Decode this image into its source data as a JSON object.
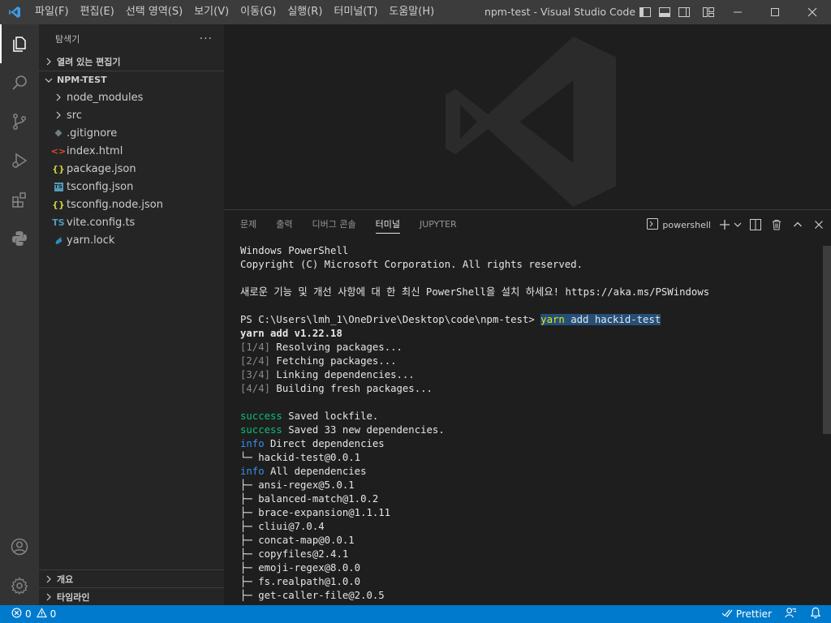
{
  "titlebar": {
    "menu": [
      "파일(F)",
      "편집(E)",
      "선택 영역(S)",
      "보기(V)",
      "이동(G)",
      "실행(R)",
      "터미널(T)",
      "도움말(H)"
    ],
    "title": "npm-test - Visual Studio Code"
  },
  "sidebar": {
    "header": "탐색기",
    "open_editors": "열려 있는 편집기",
    "project": "NPM-TEST",
    "items": [
      {
        "label": "node_modules",
        "type": "folder",
        "icon": "chevron-right-icon"
      },
      {
        "label": "src",
        "type": "folder",
        "icon": "chevron-right-icon"
      },
      {
        "label": ".gitignore",
        "type": "file",
        "icon": "gitignore-icon",
        "glyph": "◆",
        "color": "#6d8086"
      },
      {
        "label": "index.html",
        "type": "file",
        "icon": "html-icon",
        "glyph": "<>",
        "color": "#e44d26"
      },
      {
        "label": "package.json",
        "type": "file",
        "icon": "json-icon",
        "glyph": "{}",
        "color": "#cbcb41"
      },
      {
        "label": "tsconfig.json",
        "type": "file",
        "icon": "tsconfig-icon",
        "glyph": "TS",
        "color": "#519aba"
      },
      {
        "label": "tsconfig.node.json",
        "type": "file",
        "icon": "json-icon",
        "glyph": "{}",
        "color": "#cbcb41"
      },
      {
        "label": "vite.config.ts",
        "type": "file",
        "icon": "typescript-icon",
        "glyph": "TS",
        "color": "#519aba"
      },
      {
        "label": "yarn.lock",
        "type": "file",
        "icon": "yarn-icon",
        "glyph": "🐈",
        "color": "#2c8ebb"
      }
    ],
    "outline": "개요",
    "timeline": "타임라인"
  },
  "panel": {
    "tabs": [
      "문제",
      "출력",
      "디버그 콘솔",
      "터미널",
      "JUPYTER"
    ],
    "active_tab": "터미널",
    "shell": "powershell"
  },
  "terminal": {
    "lines": [
      [
        {
          "t": "Windows PowerShell",
          "c": "white"
        }
      ],
      [
        {
          "t": "Copyright (C) Microsoft Corporation. All rights reserved.",
          "c": "white"
        }
      ],
      [
        {
          "t": "",
          "c": "white"
        }
      ],
      [
        {
          "t": "새로운 기능 및 개선 사항에 대 한 최신 PowerShell을 설치 하세요! https://aka.ms/PSWindows",
          "c": "white"
        }
      ],
      [
        {
          "t": "",
          "c": "white"
        }
      ],
      [
        {
          "t": "PS C:\\Users\\lmh_1\\OneDrive\\Desktop\\code\\npm-test> ",
          "c": "white"
        },
        {
          "t": "yarn",
          "c": "yellow hl"
        },
        {
          "t": " add hackid-test",
          "c": "white hl"
        }
      ],
      [
        {
          "t": "yarn add v1.22.18",
          "c": "bold"
        }
      ],
      [
        {
          "t": "[1/4]",
          "c": "gray"
        },
        {
          "t": " Resolving packages...",
          "c": "white"
        }
      ],
      [
        {
          "t": "[2/4]",
          "c": "gray"
        },
        {
          "t": " Fetching packages...",
          "c": "white"
        }
      ],
      [
        {
          "t": "[3/4]",
          "c": "gray"
        },
        {
          "t": " Linking dependencies...",
          "c": "white"
        }
      ],
      [
        {
          "t": "[4/4]",
          "c": "gray"
        },
        {
          "t": " Building fresh packages...",
          "c": "white"
        }
      ],
      [
        {
          "t": "",
          "c": "white"
        }
      ],
      [
        {
          "t": "success",
          "c": "green"
        },
        {
          "t": " Saved lockfile.",
          "c": "white"
        }
      ],
      [
        {
          "t": "success",
          "c": "green"
        },
        {
          "t": " Saved 33 new dependencies.",
          "c": "white"
        }
      ],
      [
        {
          "t": "info",
          "c": "blue"
        },
        {
          "t": " Direct dependencies",
          "c": "white"
        }
      ],
      [
        {
          "t": "└─ hackid-test@0.0.1",
          "c": "white"
        }
      ],
      [
        {
          "t": "info",
          "c": "blue"
        },
        {
          "t": " All dependencies",
          "c": "white"
        }
      ],
      [
        {
          "t": "├─ ansi-regex@5.0.1",
          "c": "white"
        }
      ],
      [
        {
          "t": "├─ balanced-match@1.0.2",
          "c": "white"
        }
      ],
      [
        {
          "t": "├─ brace-expansion@1.1.11",
          "c": "white"
        }
      ],
      [
        {
          "t": "├─ cliui@7.0.4",
          "c": "white"
        }
      ],
      [
        {
          "t": "├─ concat-map@0.0.1",
          "c": "white"
        }
      ],
      [
        {
          "t": "├─ copyfiles@2.4.1",
          "c": "white"
        }
      ],
      [
        {
          "t": "├─ emoji-regex@8.0.0",
          "c": "white"
        }
      ],
      [
        {
          "t": "├─ fs.realpath@1.0.0",
          "c": "white"
        }
      ],
      [
        {
          "t": "├─ get-caller-file@2.0.5",
          "c": "white"
        }
      ]
    ]
  },
  "statusbar": {
    "errors": "0",
    "warnings": "0",
    "prettier": "Prettier"
  },
  "colors": {
    "accent": "#007acc",
    "titlebar": "#3c3c3c",
    "sidebar": "#252526",
    "activitybar": "#333333",
    "editor": "#1e1e1e"
  }
}
